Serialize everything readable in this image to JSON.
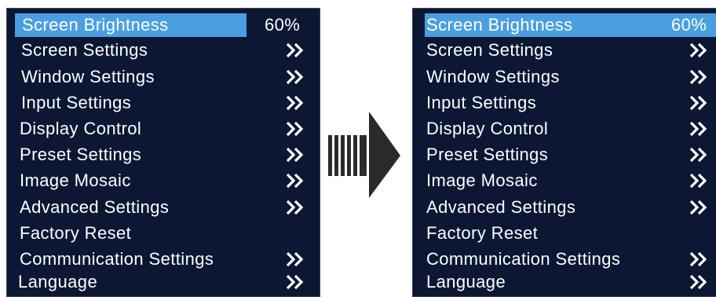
{
  "left_menu": {
    "items": [
      {
        "label": "Screen Brightness",
        "value": "60%",
        "chevron": false
      },
      {
        "label": "Screen Settings",
        "chevron": true
      },
      {
        "label": "Window Settings",
        "chevron": true
      },
      {
        "label": "Input Settings",
        "chevron": true
      },
      {
        "label": "Display Control",
        "chevron": true
      },
      {
        "label": "Preset Settings",
        "chevron": true
      },
      {
        "label": "Image Mosaic",
        "chevron": true
      },
      {
        "label": "Advanced Settings",
        "chevron": true
      },
      {
        "label": "Factory Reset",
        "chevron": false
      },
      {
        "label": "Communication Settings",
        "chevron": true
      },
      {
        "label": "Language",
        "chevron": true
      }
    ]
  },
  "right_menu": {
    "items": [
      {
        "label": "Screen Brightness",
        "value": "60%",
        "chevron": false
      },
      {
        "label": "Screen Settings",
        "chevron": true
      },
      {
        "label": "Window Settings",
        "chevron": true
      },
      {
        "label": "Input Settings",
        "chevron": true
      },
      {
        "label": "Display Control",
        "chevron": true
      },
      {
        "label": "Preset Settings",
        "chevron": true
      },
      {
        "label": "Image Mosaic",
        "chevron": true
      },
      {
        "label": "Advanced Settings",
        "chevron": true
      },
      {
        "label": "Factory Reset",
        "chevron": false
      },
      {
        "label": "Communication Settings",
        "chevron": true
      },
      {
        "label": "Language",
        "chevron": true
      }
    ]
  },
  "icons": {
    "menu_chevron": "double-chevron-right-icon",
    "transition": "right-arrow-icon"
  },
  "colors": {
    "panel_bg": "#0c1733",
    "selected_bg": "#4b9fe0",
    "text": "#ffffff",
    "arrow": "#2b2b2b"
  }
}
